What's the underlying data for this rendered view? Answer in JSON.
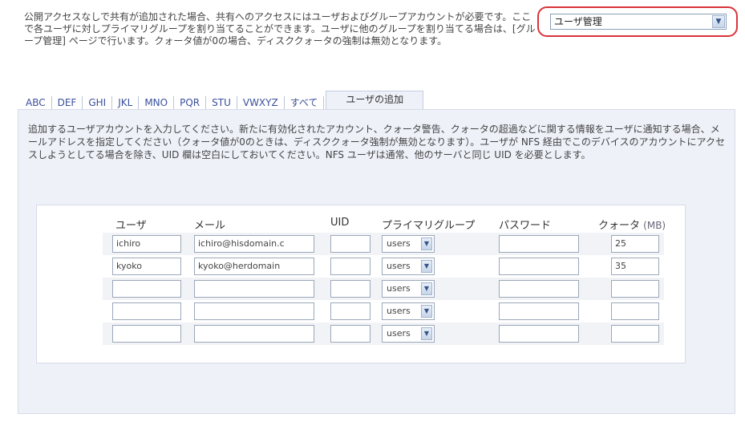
{
  "intro_text": "公開アクセスなしで共有が追加された場合、共有へのアクセスにはユーザおよびグループアカウントが必要です。ここで各ユーザに対しプライマリグループを割り当てることができます。ユーザに他のグループを割り当てる場合は、[グループ管理] ページで行います。クォータ値が0の場合、ディスククォータの強制は無効となります。",
  "mode_select": {
    "value": "ユーザ管理",
    "arrow": "▼"
  },
  "tabs": [
    "ABC",
    "DEF",
    "GHI",
    "JKL",
    "MNO",
    "PQR",
    "STU",
    "VWXYZ",
    "すべて",
    "ユーザの追加"
  ],
  "active_tab": "ユーザの追加",
  "description": "追加するユーザアカウントを入力してください。新たに有効化されたアカウント、クォータ警告、クォータの超過などに関する情報をユーザに通知する場合、メールアドレスを指定してください（クォータ値が0のときは、ディスククォータ強制が無効となります）。ユーザが NFS 経由でこのデバイスのアカウントにアクセスしようとしてる場合を除き、UID 欄は空白にしておいてください。NFS ユーザは通常、他のサーバと同じ UID を必要とします。",
  "columns": {
    "user": "ユーザ",
    "mail": "メール",
    "uid": "UID",
    "group": "プライマリグループ",
    "password": "パスワード",
    "quota": "クォータ",
    "quota_unit": "(MB)"
  },
  "rows": [
    {
      "user": "ichiro",
      "mail": "ichiro@hisdomain.c",
      "uid": "",
      "group": "users",
      "password": "",
      "quota": "25"
    },
    {
      "user": "kyoko",
      "mail": "kyoko@herdomain",
      "uid": "",
      "group": "users",
      "password": "",
      "quota": "35"
    },
    {
      "user": "",
      "mail": "",
      "uid": "",
      "group": "users",
      "password": "",
      "quota": ""
    },
    {
      "user": "",
      "mail": "",
      "uid": "",
      "group": "users",
      "password": "",
      "quota": ""
    },
    {
      "user": "",
      "mail": "",
      "uid": "",
      "group": "users",
      "password": "",
      "quota": ""
    }
  ],
  "select_arrow": "▼"
}
